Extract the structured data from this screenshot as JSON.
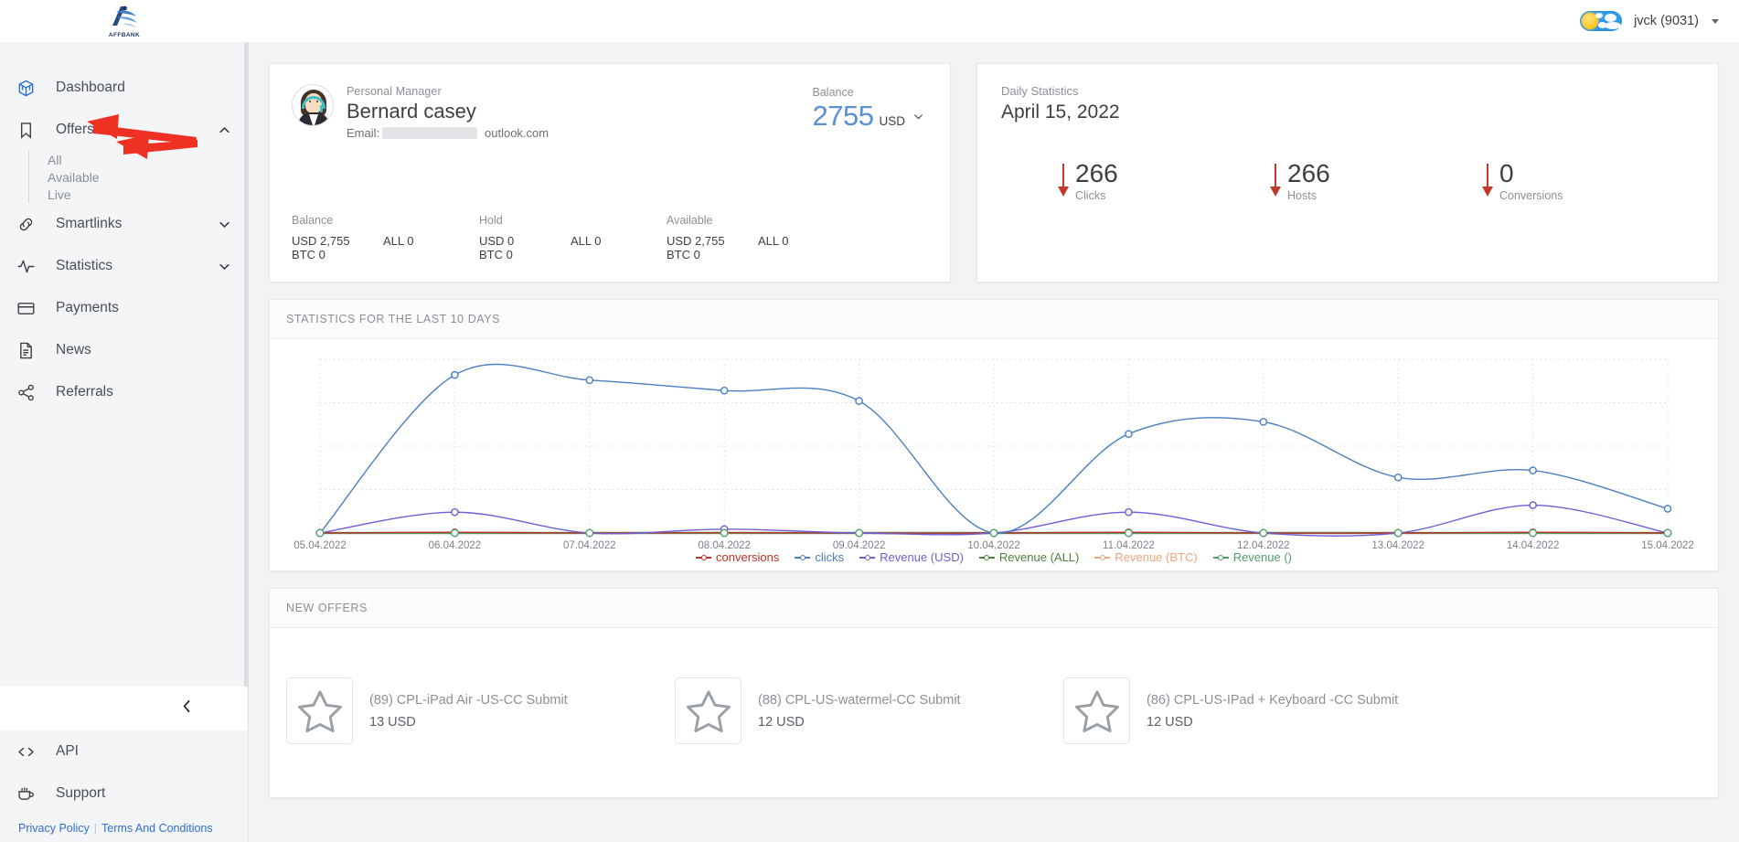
{
  "brand": {
    "name": "AFFBANK",
    "logo_icon": "affbank-logo-icon"
  },
  "topbar": {
    "user_label": "jvck (9031)",
    "theme_toggle_icon": "day-night-toggle-icon",
    "user_caret_icon": "chevron-down-icon"
  },
  "sidebar": {
    "items": [
      {
        "label": "Dashboard",
        "icon": "cube-icon",
        "expandable": false
      },
      {
        "label": "Offers",
        "icon": "bookmark-icon",
        "expandable": true,
        "expanded": true,
        "children": [
          {
            "label": "All"
          },
          {
            "label": "Available"
          },
          {
            "label": "Live"
          }
        ]
      },
      {
        "label": "Smartlinks",
        "icon": "link-icon",
        "expandable": true,
        "expanded": false
      },
      {
        "label": "Statistics",
        "icon": "pulse-icon",
        "expandable": true,
        "expanded": false
      },
      {
        "label": "Payments",
        "icon": "credit-card-icon",
        "expandable": false
      },
      {
        "label": "News",
        "icon": "document-icon",
        "expandable": false
      },
      {
        "label": "Referrals",
        "icon": "share-icon",
        "expandable": false
      }
    ],
    "collapse_icon": "chevron-left-icon",
    "footer_items": [
      {
        "label": "API",
        "icon": "code-icon"
      },
      {
        "label": "Support",
        "icon": "coffee-cup-icon"
      }
    ],
    "legal": {
      "privacy": "Privacy Policy",
      "separator": "|",
      "terms": "Terms And Conditions"
    }
  },
  "manager_card": {
    "role_label": "Personal Manager",
    "name": "Bernard casey",
    "email_prefix": "Email:",
    "email_suffix": "outlook.com",
    "avatar_icon": "support-agent-avatar",
    "balance_label": "Balance",
    "balance_amount": "2755",
    "balance_currency": "USD",
    "balance_caret_icon": "chevron-down-icon",
    "columns": [
      {
        "head": "Balance",
        "rows": [
          {
            "left": "USD 2,755",
            "right": "ALL 0"
          },
          {
            "left": "BTC 0",
            "right": ""
          }
        ]
      },
      {
        "head": "Hold",
        "rows": [
          {
            "left": "USD 0",
            "right": "ALL 0"
          },
          {
            "left": "BTC 0",
            "right": ""
          }
        ]
      },
      {
        "head": "Available",
        "rows": [
          {
            "left": "USD 2,755",
            "right": "ALL 0"
          },
          {
            "left": "BTC 0",
            "right": ""
          }
        ]
      }
    ]
  },
  "daily_statistics": {
    "label": "Daily Statistics",
    "date": "April 15, 2022",
    "arrow_icon": "arrow-down-icon",
    "metrics": [
      {
        "value": "266",
        "caption": "Clicks"
      },
      {
        "value": "266",
        "caption": "Hosts"
      },
      {
        "value": "0",
        "caption": "Conversions"
      }
    ]
  },
  "chart_card": {
    "title": "STATISTICS FOR THE LAST 10 DAYS"
  },
  "chart_data": {
    "type": "line",
    "title": "STATISTICS FOR THE LAST 10 DAYS",
    "xlabel": "",
    "ylabel": "",
    "grid": true,
    "legend_position": "bottom",
    "x": [
      "05.04.2022",
      "06.04.2022",
      "07.04.2022",
      "08.04.2022",
      "09.04.2022",
      "10.04.2022",
      "11.04.2022",
      "12.04.2022",
      "13.04.2022",
      "14.04.2022",
      "15.04.2022"
    ],
    "ylim": [
      0,
      1000
    ],
    "series": [
      {
        "name": "conversions",
        "color": "#bb3326",
        "values": [
          0,
          4,
          0,
          2,
          0,
          0,
          4,
          0,
          0,
          4,
          0
        ]
      },
      {
        "name": "clicks",
        "color": "#4a7fc1",
        "values": [
          0,
          910,
          880,
          820,
          760,
          0,
          570,
          640,
          320,
          360,
          140
        ]
      },
      {
        "name": "Revenue (USD)",
        "color": "#6f5ed6",
        "values": [
          0,
          120,
          0,
          22,
          0,
          0,
          120,
          0,
          0,
          160,
          0
        ]
      },
      {
        "name": "Revenue (ALL)",
        "color": "#4f7f3d",
        "values": [
          0,
          0,
          0,
          0,
          0,
          0,
          0,
          0,
          0,
          0,
          0
        ]
      },
      {
        "name": "Revenue (BTC)",
        "color": "#f0a57a",
        "values": [
          0,
          0,
          0,
          0,
          0,
          0,
          0,
          0,
          0,
          0,
          0
        ]
      },
      {
        "name": "Revenue ()",
        "color": "#4f9e6a",
        "values": [
          0,
          0,
          0,
          0,
          0,
          0,
          0,
          0,
          0,
          0,
          0
        ]
      }
    ]
  },
  "new_offers": {
    "title": "NEW OFFERS",
    "items": [
      {
        "name": "(89) CPL-iPad Air -US-CC Submit",
        "price": "13 USD",
        "icon": "star-outline-icon"
      },
      {
        "name": "(88) CPL-US-watermel-CC Submit",
        "price": "12 USD",
        "icon": "star-outline-icon"
      },
      {
        "name": "(86) CPL-US-IPad + Keyboard -CC Submit",
        "price": "12 USD",
        "icon": "star-outline-icon"
      }
    ]
  },
  "annotations": {
    "arrow_color": "#ef3124",
    "count": 2
  },
  "colors": {
    "accent_blue": "#2f6fd0",
    "balance_blue": "#5b8fd6",
    "sidebar_bg": "#f4f5f7",
    "page_bg": "#f1f3f5",
    "annotation_red": "#ef3124"
  }
}
